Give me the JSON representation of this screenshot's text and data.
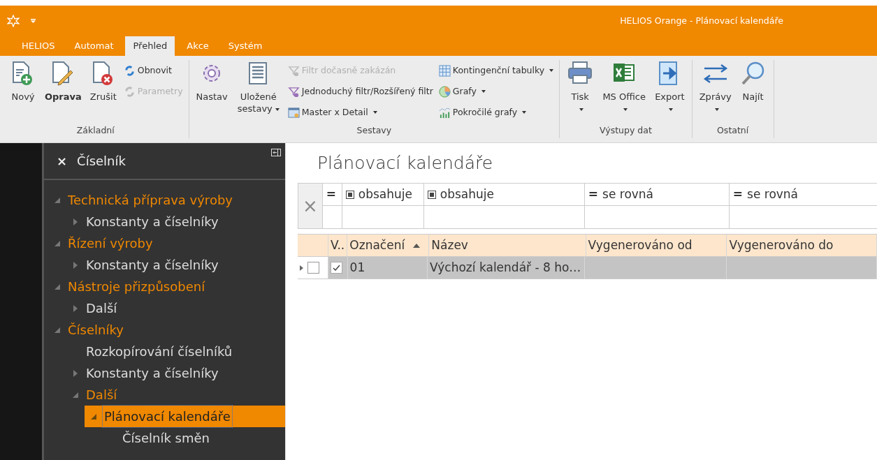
{
  "window": {
    "title": "HELIOS Orange - Plánovací kalendáře"
  },
  "tabs": [
    {
      "label": "HELIOS",
      "selected": false
    },
    {
      "label": "Automat",
      "selected": false
    },
    {
      "label": "Přehled",
      "selected": true
    },
    {
      "label": "Akce",
      "selected": false
    },
    {
      "label": "Systém",
      "selected": false
    }
  ],
  "ribbon": [
    {
      "label": "Základní",
      "items": [
        {
          "kind": "large",
          "label": "Nový",
          "bold": false
        },
        {
          "kind": "large",
          "label": "Oprava",
          "bold": true
        },
        {
          "kind": "large",
          "label": "Zrušit",
          "bold": false
        },
        {
          "kind": "small-stack",
          "items": [
            {
              "label": "Obnovit",
              "disabled": false
            },
            {
              "label": "Parametry",
              "disabled": true
            }
          ]
        }
      ]
    },
    {
      "label": "Sestavy",
      "items": [
        {
          "kind": "large",
          "label": "Nastav",
          "bold": false
        },
        {
          "kind": "large",
          "label": "Uložené sestavy",
          "bold": false,
          "dropdown": true
        },
        {
          "kind": "small-stack",
          "items": [
            {
              "label": "Filtr dočasně zakázán",
              "disabled": true
            },
            {
              "label": "Jednoduchý filtr/Rozšířený filtr",
              "disabled": false
            },
            {
              "label": "Master x Detail",
              "disabled": false,
              "dropdown": true
            }
          ]
        },
        {
          "kind": "small-stack",
          "items": [
            {
              "label": "Kontingenční tabulky",
              "disabled": false,
              "dropdown": true
            },
            {
              "label": "Grafy",
              "disabled": false,
              "dropdown": true
            },
            {
              "label": "Pokročilé grafy",
              "disabled": false,
              "dropdown": true
            }
          ]
        }
      ]
    },
    {
      "label": "Výstupy dat",
      "items": [
        {
          "kind": "large",
          "label": "Tisk",
          "bold": false,
          "dropdown": true
        },
        {
          "kind": "large",
          "label": "MS Office",
          "bold": false,
          "dropdown": true
        },
        {
          "kind": "large",
          "label": "Export",
          "bold": false,
          "dropdown": true
        }
      ]
    },
    {
      "label": "Ostatní",
      "items": [
        {
          "kind": "large",
          "label": "Zprávy",
          "bold": false,
          "dropdown": true
        },
        {
          "kind": "large",
          "label": "Najít",
          "bold": false
        }
      ]
    }
  ],
  "navigator": {
    "title": "Číselník",
    "close": "×",
    "tree": [
      {
        "label": "Technická příprava výroby",
        "expanded": true,
        "selected": false,
        "children": [
          {
            "label": "Konstanty a číselníky",
            "expanded": false,
            "selected": false
          }
        ]
      },
      {
        "label": "Řízení výroby",
        "expanded": true,
        "selected": false,
        "children": [
          {
            "label": "Konstanty a číselníky",
            "expanded": false,
            "selected": false
          }
        ]
      },
      {
        "label": "Nástroje přizpůsobení",
        "expanded": true,
        "selected": false,
        "children": [
          {
            "label": "Další",
            "expanded": false,
            "selected": false
          }
        ]
      },
      {
        "label": "Číselníky",
        "expanded": true,
        "selected": false,
        "children": [
          {
            "label": "Rozkopírování číselníků",
            "selected": false
          },
          {
            "label": "Konstanty a číselníky",
            "expanded": false,
            "selected": false
          },
          {
            "label": "Další",
            "expanded": true,
            "selected": false,
            "children": [
              {
                "label": "Plánovací kalendáře",
                "expanded": true,
                "selected": true,
                "children": [
                  {
                    "label": "Číselník směn",
                    "selected": false
                  }
                ]
              }
            ]
          }
        ]
      }
    ]
  },
  "page_title": "Plánovací kalendáře",
  "filter": {
    "clear": "×",
    "cells": [
      {
        "kind": "equals",
        "symbol": "="
      },
      {
        "kind": "contains",
        "label": "obsahuje"
      },
      {
        "kind": "contains",
        "label": "obsahuje"
      },
      {
        "kind": "equals",
        "symbol": "=",
        "label": "se rovná"
      },
      {
        "kind": "equals",
        "symbol": "=",
        "label": "se rovná"
      }
    ]
  },
  "table": {
    "columns": [
      {
        "label": "V..",
        "sorted": false
      },
      {
        "label": "Označení",
        "sorted": true
      },
      {
        "label": "Název",
        "sorted": false
      },
      {
        "label": "Vygenerováno od",
        "sorted": false
      },
      {
        "label": "Vygenerováno do",
        "sorted": false
      }
    ],
    "rows": [
      {
        "selected": true,
        "checked": false,
        "valid": true,
        "cells": [
          "",
          "01",
          "Výchozí kalendář - 8 ho…",
          "",
          ""
        ]
      }
    ]
  }
}
